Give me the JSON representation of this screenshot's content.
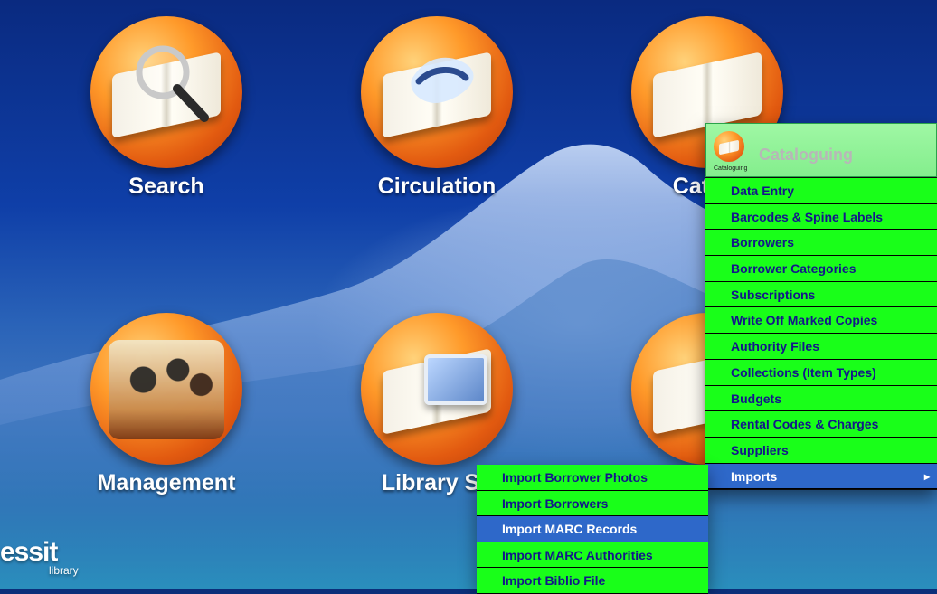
{
  "tiles": [
    {
      "name": "Search",
      "label": "Search",
      "icon": "search-icon"
    },
    {
      "name": "Circulation",
      "label": "Circulation",
      "icon": "circulation-icon"
    },
    {
      "name": "Cataloguing",
      "label": "Catalo",
      "icon": "cataloguing-icon"
    },
    {
      "name": "Management",
      "label": "Management",
      "icon": "management-icon"
    },
    {
      "name": "Library Services",
      "label": "Library Se",
      "icon": "library-services-icon"
    }
  ],
  "menu": {
    "header": {
      "title": "Cataloguing",
      "caption": "Cataloguing"
    },
    "items": [
      {
        "label": "Data Entry"
      },
      {
        "label": "Barcodes & Spine Labels"
      },
      {
        "label": "Borrowers"
      },
      {
        "label": "Borrower Categories"
      },
      {
        "label": "Subscriptions"
      },
      {
        "label": "Write Off Marked Copies"
      },
      {
        "label": "Authority Files"
      },
      {
        "label": "Collections (Item Types)"
      },
      {
        "label": "Budgets"
      },
      {
        "label": "Rental Codes & Charges"
      },
      {
        "label": "Suppliers"
      },
      {
        "label": "Imports",
        "selected": true,
        "has_submenu": true,
        "submenu_indicator": "▸"
      }
    ]
  },
  "submenu": {
    "items": [
      {
        "label": "Import Borrower Photos"
      },
      {
        "label": "Import Borrowers"
      },
      {
        "label": "Import MARC Records",
        "selected": true
      },
      {
        "label": "Import MARC Authorities"
      },
      {
        "label": "Import Biblio File"
      }
    ]
  },
  "branding": {
    "wordmark": "essit",
    "subtext": "library"
  },
  "colors": {
    "menu_green": "#19ff19",
    "menu_selected": "#2e68c9",
    "menu_text": "#13178a",
    "tile_orange": "#ff9a2a"
  }
}
